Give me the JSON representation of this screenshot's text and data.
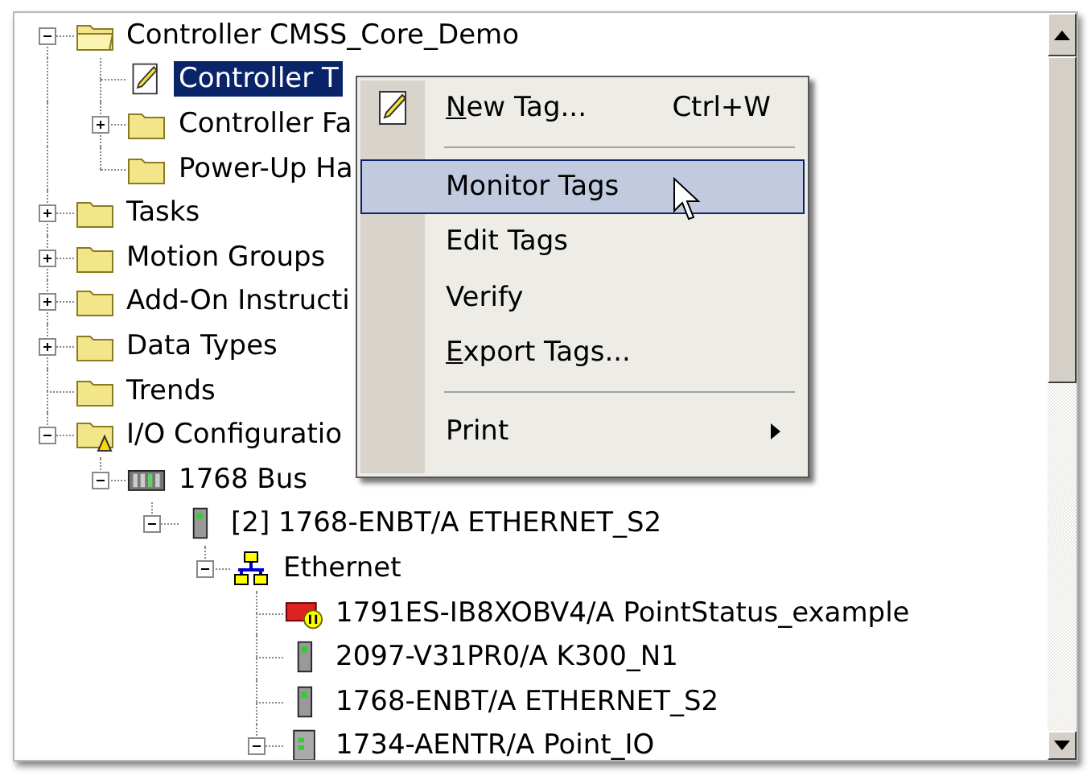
{
  "tree": [
    {
      "label": "Controller CMSS_Core_Demo",
      "kind": "folder-open",
      "expanded": true,
      "selected": false,
      "children": [
        {
          "label": "Controller T",
          "kind": "tags",
          "selected": true
        },
        {
          "label": "Controller Fa",
          "kind": "folder",
          "expanded": false,
          "selected": false
        },
        {
          "label": "Power-Up Ha",
          "kind": "folder",
          "selected": false
        }
      ]
    },
    {
      "label": "Tasks",
      "kind": "folder",
      "expanded": false,
      "selected": false
    },
    {
      "label": "Motion Groups",
      "kind": "folder",
      "expanded": false,
      "selected": false
    },
    {
      "label": "Add-On Instructi",
      "kind": "folder",
      "expanded": false,
      "selected": false
    },
    {
      "label": "Data Types",
      "kind": "folder",
      "expanded": false,
      "selected": false
    },
    {
      "label": "Trends",
      "kind": "folder",
      "selected": false
    },
    {
      "label": "I/O Configuratio",
      "kind": "io-folder",
      "expanded": true,
      "selected": false,
      "children": [
        {
          "label": "1768 Bus",
          "kind": "bus",
          "expanded": true,
          "selected": false,
          "children": [
            {
              "label": "[2] 1768-ENBT/A ETHERNET_S2",
              "kind": "module",
              "expanded": true,
              "selected": false,
              "children": [
                {
                  "label": "Ethernet",
                  "kind": "network",
                  "expanded": true,
                  "selected": false,
                  "children": [
                    {
                      "label": "1791ES-IB8XOBV4/A PointStatus_example",
                      "kind": "safety-module",
                      "selected": false
                    },
                    {
                      "label": "2097-V31PR0/A K300_N1",
                      "kind": "drive",
                      "selected": false
                    },
                    {
                      "label": "1768-ENBT/A ETHERNET_S2",
                      "kind": "module",
                      "selected": false
                    },
                    {
                      "label": "1734-AENTR/A Point_IO",
                      "kind": "adapter",
                      "expanded": true,
                      "selected": false
                    }
                  ]
                }
              ]
            }
          ]
        }
      ]
    }
  ],
  "context_menu": [
    {
      "kind": "item",
      "label": "New Tag...",
      "underline_first": true,
      "shortcut": "Ctrl+W",
      "icon": true,
      "submenu": false,
      "selected": false
    },
    {
      "kind": "separator"
    },
    {
      "kind": "item",
      "label": "Monitor Tags",
      "icon": false,
      "submenu": false,
      "selected": true
    },
    {
      "kind": "item",
      "label": "Edit Tags",
      "icon": false,
      "submenu": false,
      "selected": false
    },
    {
      "kind": "item",
      "label": "Verify",
      "icon": false,
      "submenu": false,
      "selected": false
    },
    {
      "kind": "item",
      "label": "Export Tags...",
      "underline_first": true,
      "icon": false,
      "submenu": false,
      "selected": false
    },
    {
      "kind": "separator"
    },
    {
      "kind": "item",
      "label": "Print",
      "icon": false,
      "submenu": true,
      "selected": false
    }
  ]
}
